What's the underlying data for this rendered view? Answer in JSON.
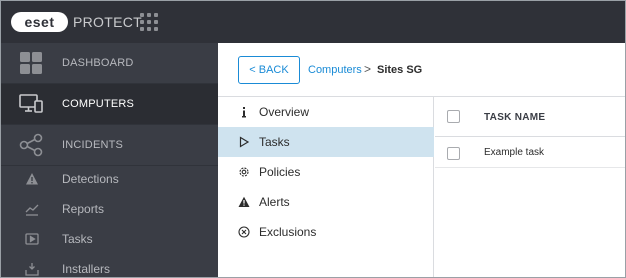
{
  "header": {
    "logo_text": "eset",
    "product_name": "PROTECT"
  },
  "sidebar": {
    "main": [
      {
        "label": "DASHBOARD",
        "icon": "dashboard-icon"
      },
      {
        "label": "COMPUTERS",
        "icon": "computers-icon",
        "active": true
      },
      {
        "label": "INCIDENTS",
        "icon": "incidents-icon"
      }
    ],
    "sub": [
      {
        "label": "Detections",
        "icon": "warning-icon"
      },
      {
        "label": "Reports",
        "icon": "chart-icon"
      },
      {
        "label": "Tasks",
        "icon": "play-icon"
      },
      {
        "label": "Installers",
        "icon": "installer-icon"
      }
    ]
  },
  "toolbar": {
    "back_label": "< BACK",
    "breadcrumb_link": "Computers",
    "breadcrumb_sep": ">",
    "breadcrumb_current": "Sites SG"
  },
  "menu": {
    "items": [
      {
        "label": "Overview",
        "icon": "info-icon"
      },
      {
        "label": "Tasks",
        "icon": "play-outline-icon",
        "active": true
      },
      {
        "label": "Policies",
        "icon": "gear-icon"
      },
      {
        "label": "Alerts",
        "icon": "warning-icon"
      },
      {
        "label": "Exclusions",
        "icon": "circle-x-icon"
      }
    ]
  },
  "table": {
    "columns": [
      "TASK NAME"
    ],
    "rows": [
      {
        "task_name": "Example task"
      }
    ]
  },
  "colors": {
    "topbar": "#2f3138",
    "sidebar": "#3a3d45",
    "accent": "#1a8bd6",
    "active_menu": "#cfe3ef"
  }
}
